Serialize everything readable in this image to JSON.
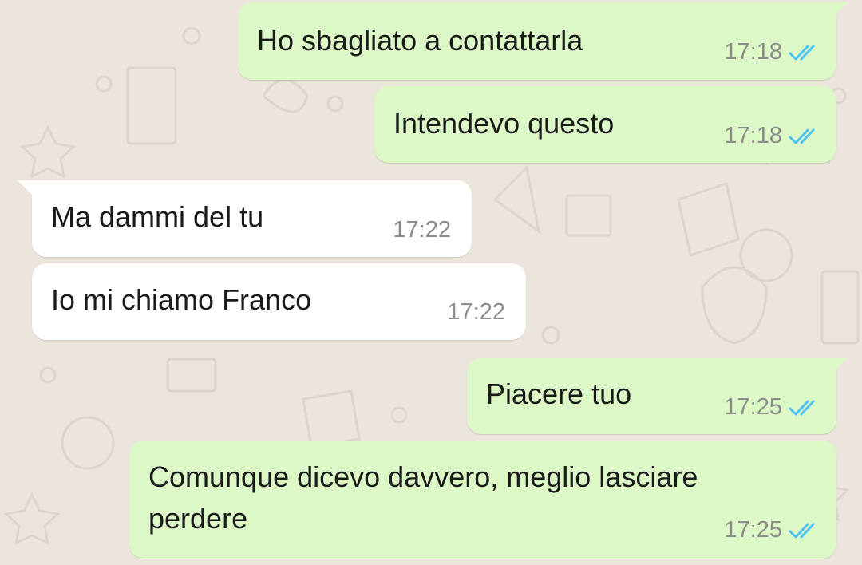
{
  "chat": {
    "colors": {
      "background": "#ece5dd",
      "outgoing_bubble": "#dcf8c6",
      "incoming_bubble": "#ffffff",
      "read_ticks": "#4fc3f7",
      "timestamp": "#8c8c8c"
    },
    "messages": [
      {
        "direction": "outgoing",
        "text": "Ho sbagliato a contattarla",
        "time": "17:18",
        "status": "read",
        "status_icon": "double-check-icon"
      },
      {
        "direction": "outgoing",
        "text": "Intendevo questo",
        "time": "17:18",
        "status": "read",
        "status_icon": "double-check-icon"
      },
      {
        "direction": "incoming",
        "text": "Ma dammi del tu",
        "time": "17:22"
      },
      {
        "direction": "incoming",
        "text": "Io mi chiamo Franco",
        "time": "17:22"
      },
      {
        "direction": "outgoing",
        "text": "Piacere tuo",
        "time": "17:25",
        "status": "read",
        "status_icon": "double-check-icon"
      },
      {
        "direction": "outgoing",
        "text": "Comunque dicevo davvero, meglio lasciare\nperdere",
        "time": "17:25",
        "status": "read",
        "status_icon": "double-check-icon"
      }
    ]
  }
}
